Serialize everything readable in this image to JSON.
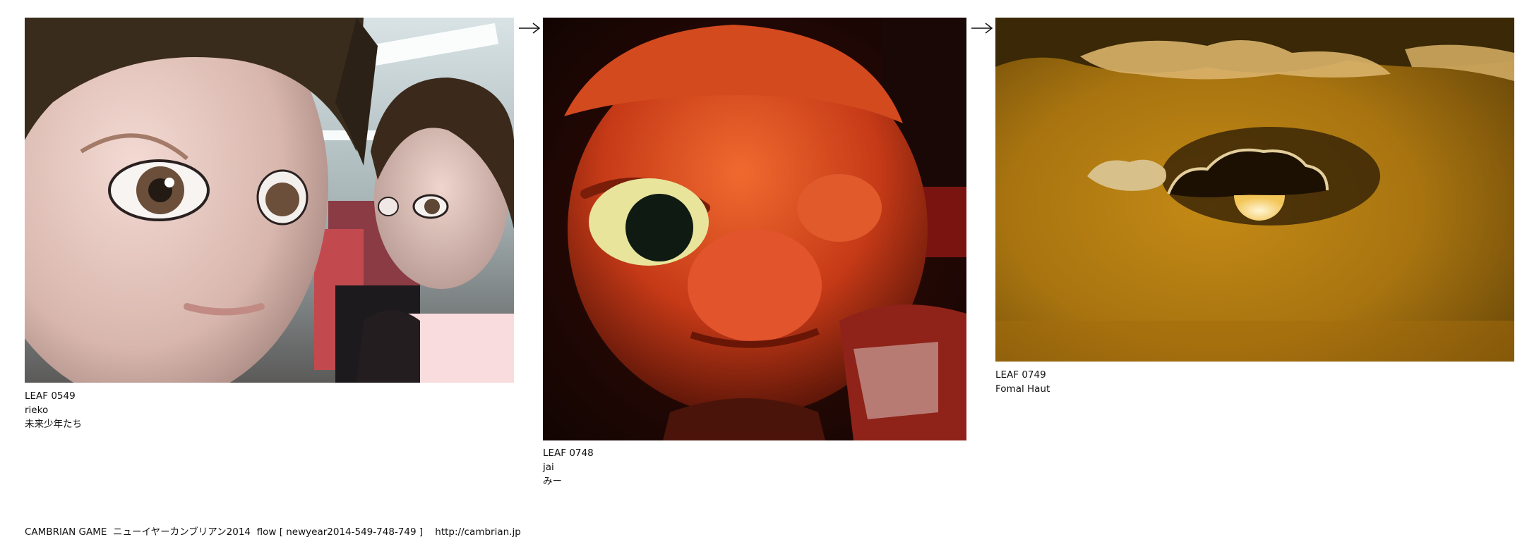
{
  "leaves": [
    {
      "id": "LEAF 0549",
      "author": "rieko",
      "title": "未来少年たち",
      "photo_icon": "mannequin-heads-photo"
    },
    {
      "id": "LEAF 0748",
      "author": "jai",
      "title": "みー",
      "photo_icon": "orange-doll-face-photo"
    },
    {
      "id": "LEAF 0749",
      "author": "Fomal Haut",
      "title": "",
      "photo_icon": "sun-behind-clouds-photo"
    }
  ],
  "arrows": [
    "→",
    "→"
  ],
  "footer": {
    "text": "CAMBRIAN GAME  ニューイヤーカンブリアン2014  flow [ newyear2014-549-748-749 ]    http://cambrian.jp"
  },
  "colors": {
    "background": "#ffffff",
    "text": "#111111"
  }
}
